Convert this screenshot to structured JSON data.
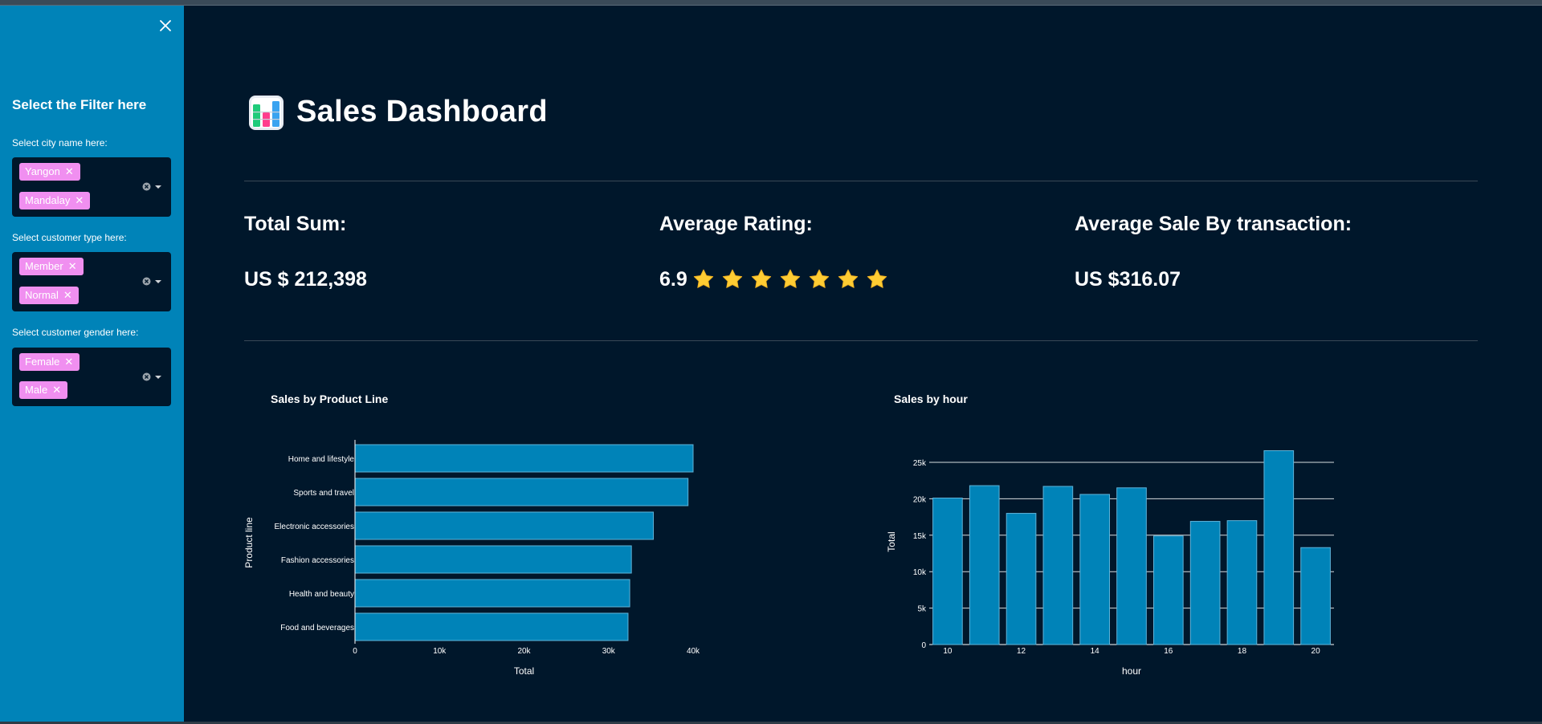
{
  "sidebar": {
    "title": "Select the Filter here",
    "filters": [
      {
        "label": "Select city name here:",
        "selected": [
          "Yangon",
          "Mandalay"
        ]
      },
      {
        "label": "Select customer type here:",
        "selected": [
          "Member",
          "Normal"
        ]
      },
      {
        "label": "Select customer gender here:",
        "selected": [
          "Female",
          "Male"
        ]
      }
    ],
    "tag_color": "#f08ff0",
    "background": "#0083b8"
  },
  "header": {
    "title": "Sales Dashboard",
    "icon": "bar-chart-icon"
  },
  "metrics": [
    {
      "label": "Total Sum:",
      "value": "US $ 212,398"
    },
    {
      "label": "Average Rating:",
      "value": "6.9",
      "stars": 7,
      "star_icon": "star-icon"
    },
    {
      "label": "Average Sale By transaction:",
      "value": "US $316.07"
    }
  ],
  "chart_data": [
    {
      "type": "bar",
      "orientation": "horizontal",
      "title": "Sales by Product Line",
      "xlabel": "Total",
      "ylabel": "Product line",
      "categories": [
        "Home and lifestyle",
        "Sports and travel",
        "Electronic accessories",
        "Fashion accessories",
        "Health and beauty",
        "Food and beverages"
      ],
      "values": [
        40000,
        39400,
        35300,
        32700,
        32500,
        32300
      ],
      "xticks": [
        "0",
        "10k",
        "20k",
        "30k",
        "40k"
      ],
      "xlim": [
        0,
        40000
      ],
      "bar_color": "#0083b8",
      "grid": false
    },
    {
      "type": "bar",
      "title": "Sales by hour",
      "xlabel": "hour",
      "ylabel": "Total",
      "x": [
        10,
        11,
        12,
        13,
        14,
        15,
        16,
        17,
        18,
        19,
        20
      ],
      "values": [
        20100,
        21800,
        18000,
        21700,
        20600,
        21500,
        14900,
        16900,
        17000,
        26600,
        13300
      ],
      "xticks": [
        "10",
        "12",
        "14",
        "16",
        "18",
        "20"
      ],
      "yticks": [
        "0",
        "5k",
        "10k",
        "15k",
        "20k",
        "25k"
      ],
      "ylim": [
        0,
        25000
      ],
      "bar_color": "#0083b8",
      "grid": true
    }
  ]
}
